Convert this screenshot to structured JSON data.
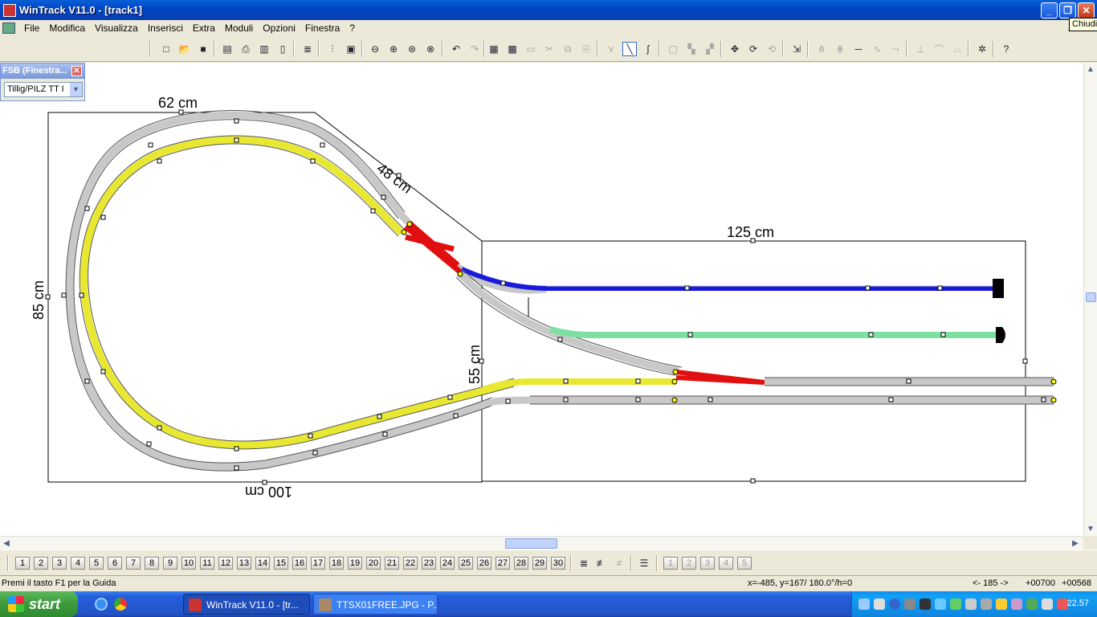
{
  "window": {
    "title": "WinTrack  V11.0 - [track1]",
    "tooltip": "Chiudi",
    "min_glyph": "_",
    "max_glyph": "❐",
    "close_glyph": "✕"
  },
  "menu": {
    "items": [
      "File",
      "Modifica",
      "Visualizza",
      "Inserisci",
      "Extra",
      "Moduli",
      "Opzioni",
      "Finestra",
      "?"
    ],
    "mdi_minimize_glyph": "_"
  },
  "toolbar": {
    "buttons": [
      "new-icon",
      "open-icon",
      "save-icon",
      "print-preview-icon",
      "print-icon",
      "print-setup-icon",
      "page-icon",
      "layers-icon",
      "config-icon",
      "image-icon",
      "zoom-out-icon",
      "zoom-in-icon",
      "zoom-window-icon",
      "zoom-all-icon",
      "undo-icon",
      "redo-icon",
      "parts-list-icon",
      "module-icon",
      "text-icon",
      "cut-icon",
      "copy-icon",
      "paste-icon",
      "turnout-icon",
      "straight-track-icon",
      "curve-track-icon",
      "group-icon",
      "align-icon",
      "connect-icon",
      "move-icon",
      "rotate-icon",
      "rotate-180-icon",
      "insert-point-icon",
      "split-icon",
      "join-icon",
      "measure-icon",
      "flex-icon",
      "slope-icon",
      "height-icon",
      "bridge-icon",
      "tunnel-icon",
      "snap-icon",
      "help-icon"
    ]
  },
  "fsb": {
    "title": "FSB (Finestra...",
    "close_glyph": "✕",
    "selected_library": "Tillig/PILZ  TT I",
    "dropdown_glyph": "▼"
  },
  "drawing": {
    "dimension_labels": {
      "top_width": "62 cm",
      "diagonal": "48 cm",
      "left_height": "85 cm",
      "bottom_width": "100 cm",
      "right_width": "125 cm",
      "right_height": "55 cm"
    },
    "colors": {
      "track_grey": "#c8c8c8",
      "track_yellow": "#e8e830",
      "track_blue": "#1a1adc",
      "track_green": "#7de0a0",
      "turnout_red": "#e01010",
      "outline": "#000000"
    }
  },
  "scroll": {
    "left_arrow": "◀",
    "right_arrow": "▶",
    "up_arrow": "▲",
    "down_arrow": "▼"
  },
  "layers": {
    "labels": [
      "1",
      "2",
      "3",
      "4",
      "5",
      "6",
      "7",
      "8",
      "9",
      "10",
      "11",
      "12",
      "13",
      "14",
      "15",
      "16",
      "17",
      "18",
      "19",
      "20",
      "21",
      "22",
      "23",
      "24",
      "25",
      "26",
      "27",
      "28",
      "29",
      "30"
    ],
    "extra_buttons": [
      "1",
      "2",
      "3",
      "4",
      "5"
    ]
  },
  "status": {
    "help": "Premi il tasto F1 per la Guida",
    "coords": "x=-485, y=167/ 180.0°/h=0",
    "step": "<- 185 ->",
    "pos1": "+00700",
    "pos2": "+00568"
  },
  "taskbar": {
    "start_label": "start",
    "tasks": [
      "WinTrack  V11.0 - [tr...",
      "TTSX01FREE.JPG - P..."
    ],
    "clock": "22.57"
  }
}
